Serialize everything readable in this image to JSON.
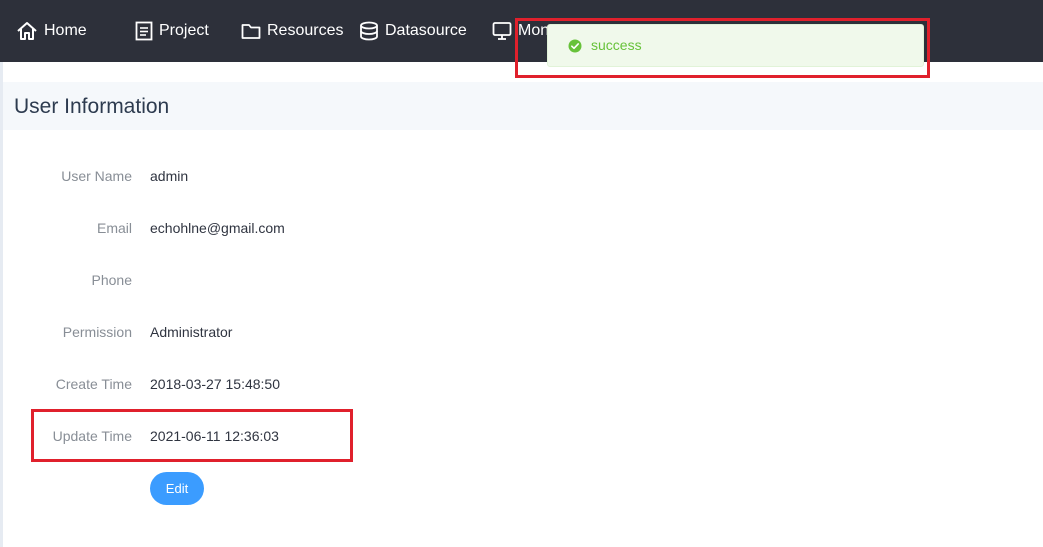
{
  "nav": {
    "items": [
      {
        "label": "Home",
        "icon": "home-icon"
      },
      {
        "label": "Project",
        "icon": "document-icon"
      },
      {
        "label": "Resources",
        "icon": "folder-icon"
      },
      {
        "label": "Datasource",
        "icon": "database-icon"
      },
      {
        "label": "Mon",
        "icon": "monitor-icon"
      }
    ]
  },
  "page": {
    "title": "User Information"
  },
  "user_info": {
    "rows": [
      {
        "label": "User Name",
        "value": "admin"
      },
      {
        "label": "Email",
        "value": "echohlne@gmail.com"
      },
      {
        "label": "Phone",
        "value": ""
      },
      {
        "label": "Permission",
        "value": "Administrator"
      },
      {
        "label": "Create Time",
        "value": "2018-03-27 15:48:50"
      },
      {
        "label": "Update Time",
        "value": "2021-06-11 12:36:03"
      }
    ],
    "edit_label": "Edit"
  },
  "toast": {
    "message": "success",
    "icon": "check-circle-icon",
    "color": "#67c23a"
  },
  "colors": {
    "topbar": "#2d303a",
    "primary_button": "#3b9cff",
    "highlight": "#e0202c"
  }
}
